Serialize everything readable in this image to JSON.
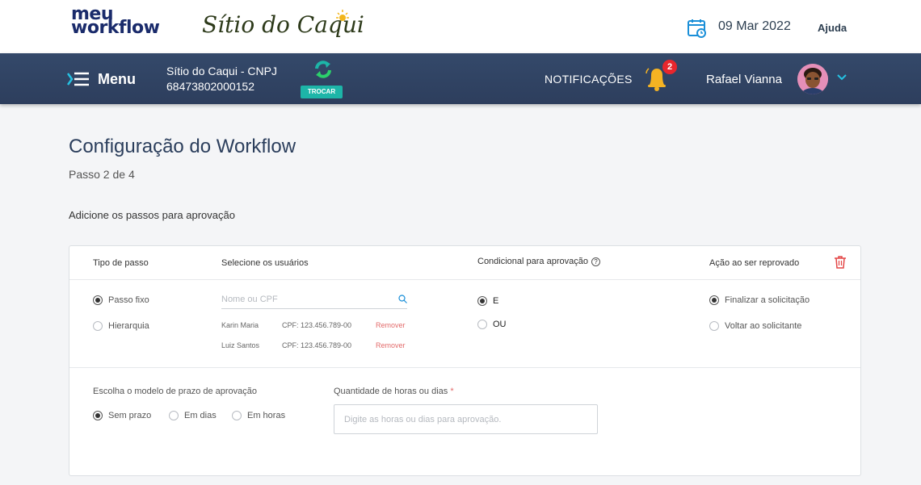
{
  "header": {
    "logo_top": "meu",
    "logo_bottom": "workflow",
    "client_logo": "Sítio do Caqui",
    "date": "09 Mar 2022",
    "help": "Ajuda"
  },
  "navbar": {
    "menu_label": "Menu",
    "company_name": "Sítio do Caqui - CNPJ",
    "company_cnpj": "68473802000152",
    "swap_label": "TROCAR",
    "notifications_label": "NOTIFICAÇÕES",
    "notifications_count": "2",
    "user_name": "Rafael Vianna"
  },
  "page": {
    "title": "Configuração do Workflow",
    "step": "Passo 2 de 4",
    "instruction": "Adicione os passos para aprovação"
  },
  "step_card": {
    "headers": {
      "step_type": "Tipo de passo",
      "select_users": "Selecione os usuários",
      "approval_condition": "Condicional para aprovação",
      "reject_action": "Ação ao ser reprovado"
    },
    "step_type_options": [
      {
        "label": "Passo fixo",
        "selected": true
      },
      {
        "label": "Hierarquia",
        "selected": false
      }
    ],
    "search": {
      "placeholder": "Nome ou CPF",
      "value": ""
    },
    "users": [
      {
        "name": "Karin Maria",
        "cpf": "CPF: 123.456.789-00",
        "remove": "Remover"
      },
      {
        "name": "Luiz Santos",
        "cpf": "CPF: 123.456.789-00",
        "remove": "Remover"
      }
    ],
    "condition_options": [
      {
        "label": "E",
        "selected": true
      },
      {
        "label": "OU",
        "selected": false
      }
    ],
    "reject_options": [
      {
        "label": "Finalizar a solicitação",
        "selected": true
      },
      {
        "label": "Voltar ao solicitante",
        "selected": false
      }
    ],
    "deadline": {
      "label": "Escolha o modelo de prazo de aprovação",
      "options": [
        {
          "label": "Sem prazo",
          "selected": true
        },
        {
          "label": "Em dias",
          "selected": false
        },
        {
          "label": "Em horas",
          "selected": false
        }
      ]
    },
    "quantity": {
      "label": "Quantidade de horas ou dias",
      "required_mark": "*",
      "placeholder": "Digite as horas ou dias para aprovação.",
      "value": ""
    }
  },
  "colors": {
    "navbar": "#2d3e5d",
    "accent_teal": "#1db5a8",
    "danger": "#e36b6b",
    "badge": "#e8262d",
    "title": "#2b3e5c"
  },
  "icons": [
    "calendar-icon",
    "hamburger-menu-icon",
    "swap-icon",
    "bell-icon",
    "chevron-down-icon",
    "help-circle-icon",
    "trash-icon",
    "search-icon"
  ]
}
